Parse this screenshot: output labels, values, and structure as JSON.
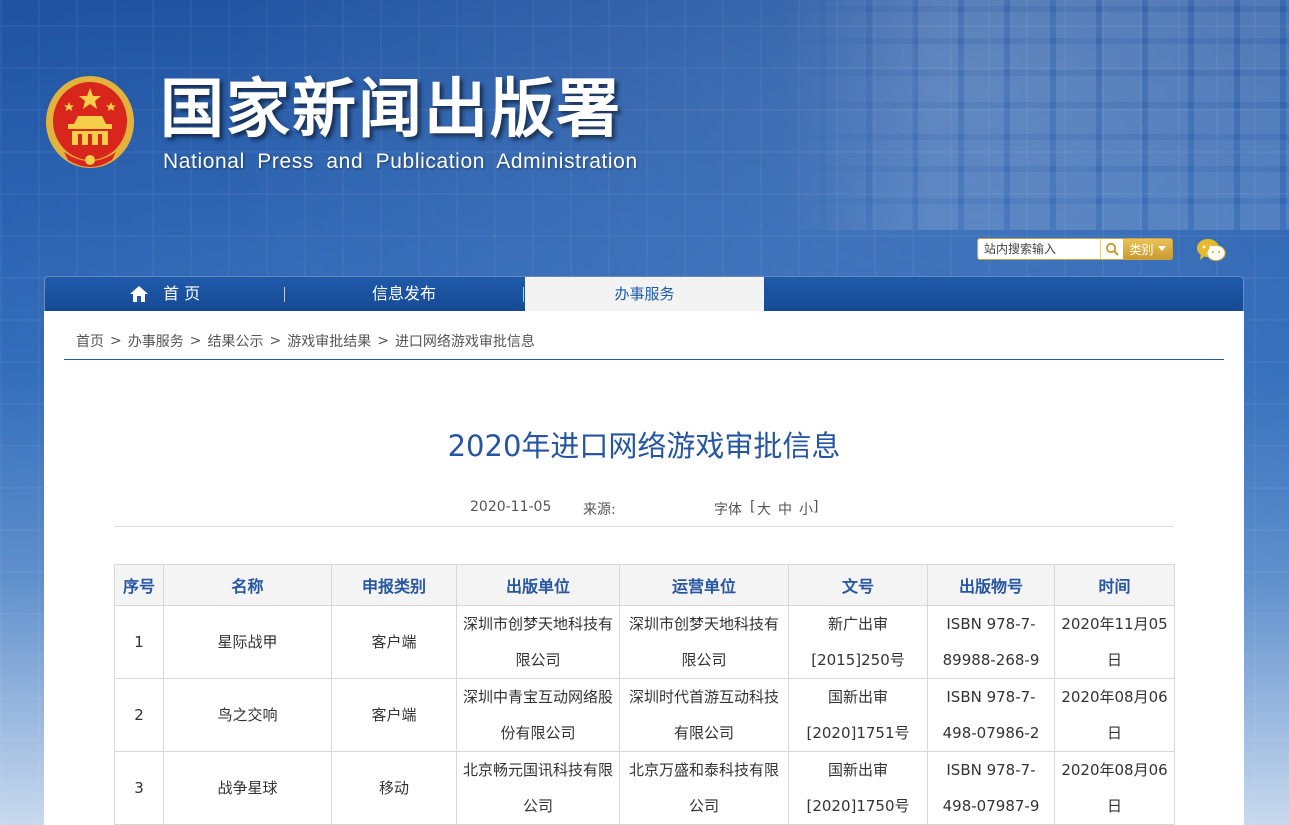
{
  "header": {
    "title_cn": "国家新闻出版署",
    "title_en": "National  Press and Publication Administration",
    "search_placeholder": "站内搜索输入",
    "category_label": "类别"
  },
  "nav": {
    "home": "首 页",
    "info": "信息发布",
    "service": "办事服务"
  },
  "breadcrumb": [
    "首页",
    "办事服务",
    "结果公示",
    "游戏审批结果",
    "进口网络游戏审批信息"
  ],
  "article": {
    "title": "2020年进口网络游戏审批信息",
    "date": "2020-11-05",
    "source_label": "来源:",
    "font_label": "字体",
    "font_open": "[",
    "font_large": "大",
    "font_medium": "中",
    "font_small": "小",
    "font_close": "]"
  },
  "table": {
    "headers": [
      "序号",
      "名称",
      "申报类别",
      "出版单位",
      "运营单位",
      "文号",
      "出版物号",
      "时间"
    ],
    "rows": [
      [
        "1",
        "星际战甲",
        "客户端",
        "深圳市创梦天地科技有限公司",
        "深圳市创梦天地科技有限公司",
        "新广出审[2015]250号",
        "ISBN 978-7-89988-268-9",
        "2020年11月05日"
      ],
      [
        "2",
        "鸟之交响",
        "客户端",
        "深圳中青宝互动网络股份有限公司",
        "深圳时代首游互动科技有限公司",
        "国新出审[2020]1751号",
        "ISBN 978-7-498-07986-2",
        "2020年08月06日"
      ],
      [
        "3",
        "战争星球",
        "移动",
        "北京畅元国讯科技有限公司",
        "北京万盛和泰科技有限公司",
        "国新出审[2020]1750号",
        "ISBN 978-7-498-07987-9",
        "2020年08月06日"
      ]
    ]
  },
  "colors": {
    "brand_blue": "#1f5aab",
    "title_blue": "#2656a3",
    "gold": "#c99a2e",
    "emblem_red": "#d8261c"
  }
}
